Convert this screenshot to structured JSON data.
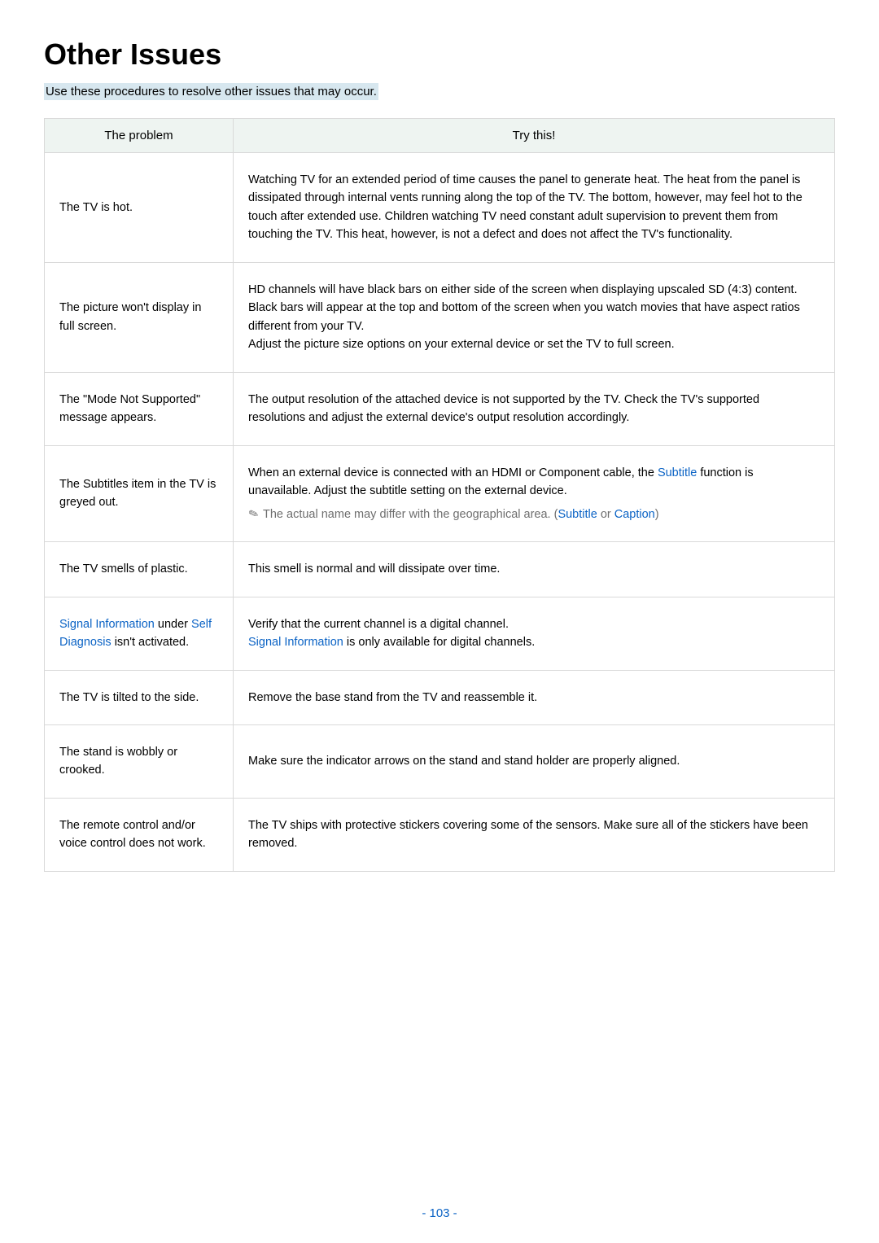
{
  "title": "Other Issues",
  "intro": "Use these procedures to resolve other issues that may occur.",
  "table": {
    "header_problem": "The problem",
    "header_try": "Try this!",
    "rows": [
      {
        "problem": "The TV is hot.",
        "solution": "Watching TV for an extended period of time causes the panel to generate heat. The heat from the panel is dissipated through internal vents running along the top of the TV. The bottom, however, may feel hot to the touch after extended use. Children watching TV need constant adult supervision to prevent them from touching the TV. This heat, however, is not a defect and does not affect the TV's functionality."
      },
      {
        "problem": "The picture won't display in full screen.",
        "solution_p1": "HD channels will have black bars on either side of the screen when displaying upscaled SD (4:3) content.",
        "solution_p2": "Black bars will appear at the top and bottom of the screen when you watch movies that have aspect ratios different from your TV.",
        "solution_p3": "Adjust the picture size options on your external device or set the TV to full screen."
      },
      {
        "problem": "The \"Mode Not Supported\" message appears.",
        "solution": "The output resolution of the attached device is not supported by the TV. Check the TV's supported resolutions and adjust the external device's output resolution accordingly."
      },
      {
        "problem": "The Subtitles item in the TV is greyed out.",
        "solution_p1_a": "When an external device is connected with an HDMI or Component cable, the ",
        "solution_p1_link": "Subtitle",
        "solution_p1_b": " function is unavailable. Adjust the subtitle setting on the external device.",
        "note_a": "The actual name may differ with the geographical area. (",
        "note_link1": "Subtitle",
        "note_mid": " or ",
        "note_link2": "Caption",
        "note_b": ")"
      },
      {
        "problem": "The TV smells of plastic.",
        "solution": "This smell is normal and will dissipate over time."
      },
      {
        "problem_link1": "Signal Information",
        "problem_mid1": " under ",
        "problem_link2": "Self Diagnosis",
        "problem_mid2": " isn't activated.",
        "solution_p1": "Verify that the current channel is a digital channel.",
        "solution_p2_link": "Signal Information",
        "solution_p2_b": " is only available for digital channels."
      },
      {
        "problem": "The TV is tilted to the side.",
        "solution": "Remove the base stand from the TV and reassemble it."
      },
      {
        "problem": "The stand is wobbly or crooked.",
        "solution": "Make sure the indicator arrows on the stand and stand holder are properly aligned."
      },
      {
        "problem": "The remote control and/or voice control does not work.",
        "solution": "The TV ships with protective stickers covering some of the sensors. Make sure all of the stickers have been removed."
      }
    ]
  },
  "page_number": "- 103 -"
}
